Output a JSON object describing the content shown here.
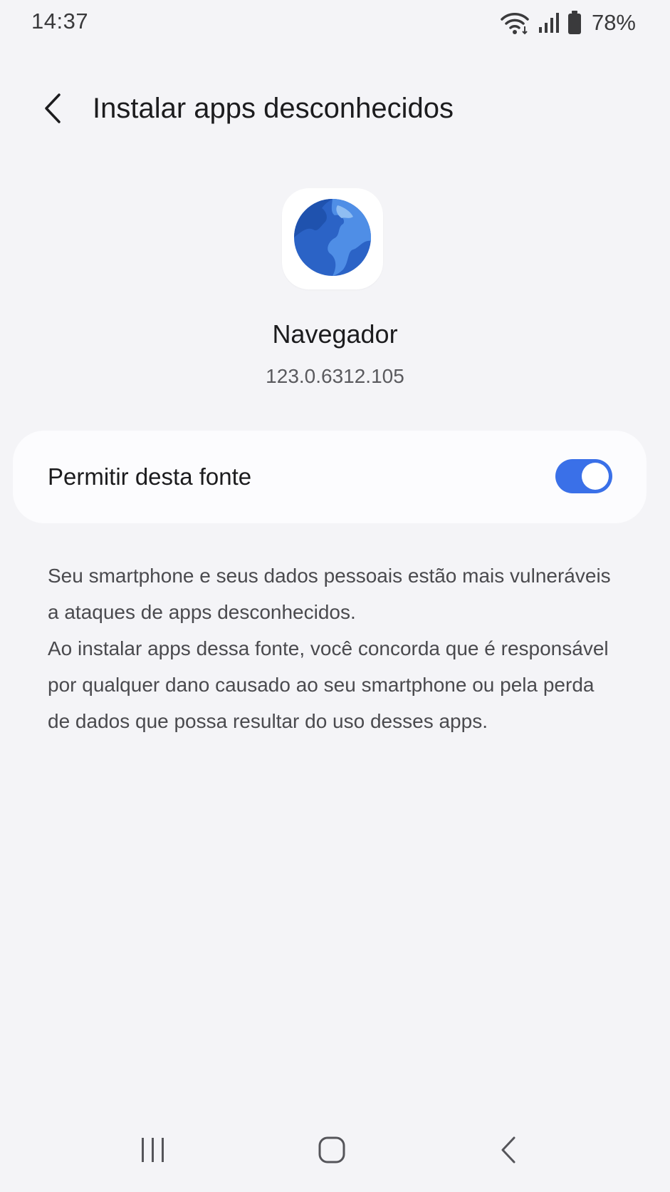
{
  "status_bar": {
    "time": "14:37",
    "battery": "78%",
    "icons": [
      "wifi-icon",
      "signal-icon",
      "battery-icon"
    ]
  },
  "header": {
    "title": "Instalar apps desconhecidos",
    "back_icon": "chevron-left-icon"
  },
  "app": {
    "name": "Navegador",
    "version": "123.0.6312.105",
    "icon": "globe-icon"
  },
  "setting": {
    "label": "Permitir desta fonte",
    "enabled": true,
    "accent_color": "#3a70e8"
  },
  "description": {
    "line1": "Seu smartphone e seus dados pessoais estão mais vulneráveis a ataques de apps desconhecidos.",
    "line2": "Ao instalar apps dessa fonte, você concorda que é responsável por qualquer dano causado ao seu smartphone ou pela perda de dados que possa resultar do uso desses apps."
  },
  "nav_bar": {
    "icons": [
      "recents-icon",
      "home-icon",
      "back-icon"
    ]
  }
}
